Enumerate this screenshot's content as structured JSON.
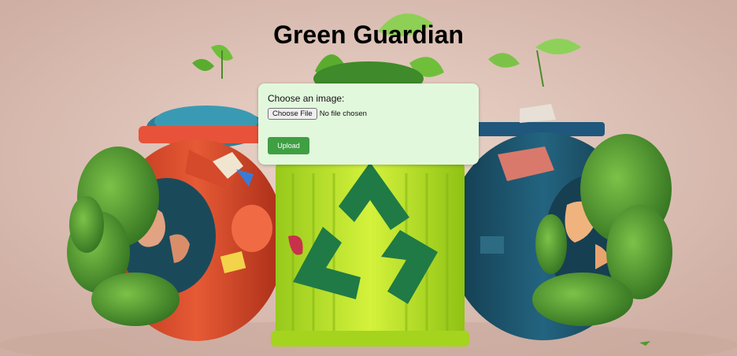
{
  "page": {
    "title": "Green Guardian"
  },
  "upload_form": {
    "label": "Choose an image:",
    "file_button_label": "Choose File",
    "file_status": "No file chosen",
    "submit_label": "Upload"
  },
  "background": {
    "description_icon": "recycling-bins-illustration",
    "colors": {
      "backdrop": "#e2c6bb",
      "left_bin": "#d9452b",
      "center_bin": "#b8e62a",
      "right_bin": "#1d4f66",
      "foliage": "#4e9a2e",
      "recycle_symbol": "#1f7a45"
    }
  },
  "colors": {
    "card_background": "#e2f8dd",
    "upload_button": "#3f9f43"
  }
}
